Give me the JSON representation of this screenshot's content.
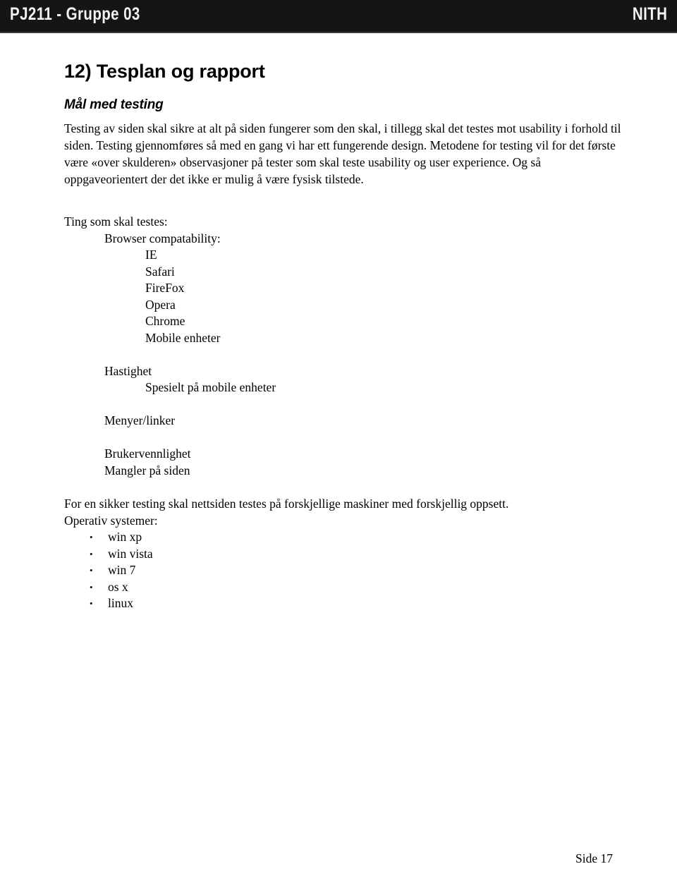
{
  "header": {
    "course": "PJ211 - Gruppe 03",
    "logo": "NITH",
    "background_color": "#151515",
    "text_color": "#f2f2f2"
  },
  "document": {
    "title": "12) Tesplan og rapport",
    "subtitle": "Mål med testing",
    "intro_paragraph": "Testing av siden skal sikre at alt på siden fungerer som den skal, i tillegg skal det testes mot usability i forhold til siden. Testing gjennomføres så med en gang vi har ett fungerende design. Metodene for testing vil for det første være «over skulderen» observasjoner på tester som skal teste usability og user experience. Og så oppgaveorientert der det ikke er mulig å være fysisk tilstede.",
    "outline": {
      "heading": "Ting som skal testes:",
      "browser_group_label": "Browser compatability:",
      "browsers": [
        "IE",
        "Safari",
        "FireFox",
        "Opera",
        "Chrome",
        "Mobile enheter"
      ],
      "speed_label": "Hastighet",
      "speed_detail": "Spesielt på mobile enheter",
      "menus_label": "Menyer/linker",
      "usability_label": "Brukervennlighet",
      "missing_label": "Mangler på siden"
    },
    "closing": {
      "line1": "For en sikker testing skal nettsiden testes på forskjellige maskiner med forskjellig oppsett.",
      "line2": "Operativ systemer:",
      "bullet_glyph": "•",
      "operating_systems": [
        "win xp",
        "win vista",
        "win 7",
        "os x",
        "linux"
      ]
    }
  },
  "footer": {
    "page_label": "Side 17"
  }
}
